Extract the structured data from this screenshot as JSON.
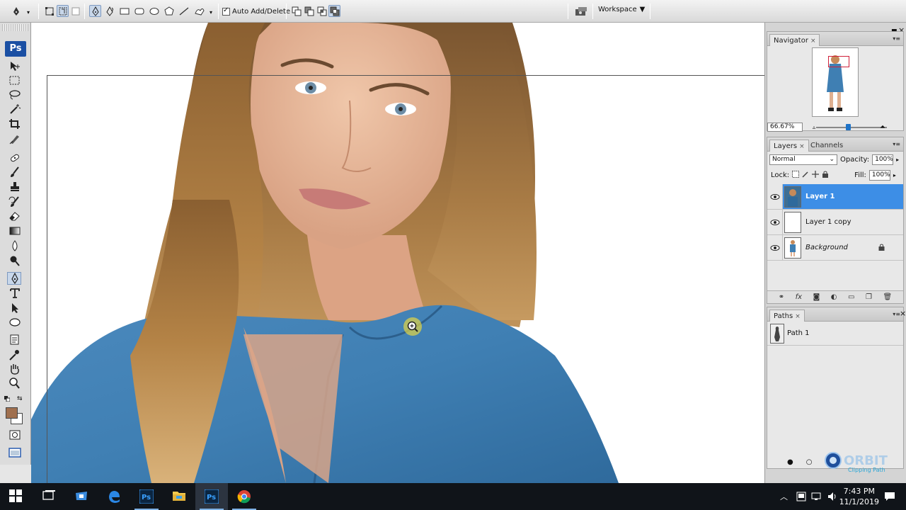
{
  "options_bar": {
    "auto_add_delete_label": "Auto Add/Delete",
    "auto_add_delete_checked": true,
    "workspace_label": "Workspace"
  },
  "toolbox": {
    "logo": "Ps",
    "foreground_color": "#a0704f",
    "background_color": "#ffffff",
    "selected_tool": "pen-tool"
  },
  "navigator": {
    "tab_label": "Navigator",
    "zoom": "66.67%",
    "zoom_slider_fraction": 0.45
  },
  "layers_panel": {
    "tabs": [
      "Layers",
      "Channels"
    ],
    "blend_mode": "Normal",
    "opacity_label": "Opacity:",
    "opacity_value": "100%",
    "lock_label": "Lock:",
    "fill_label": "Fill:",
    "fill_value": "100%",
    "layers": [
      {
        "name": "Layer 1",
        "visible": true,
        "selected": true,
        "locked": false
      },
      {
        "name": "Layer 1 copy",
        "visible": true,
        "selected": false,
        "locked": false
      },
      {
        "name": "Background",
        "visible": true,
        "selected": false,
        "locked": true
      }
    ]
  },
  "paths_panel": {
    "tab_label": "Paths",
    "paths": [
      {
        "name": "Path 1"
      }
    ]
  },
  "watermark": {
    "brand": "ORBIT",
    "tagline": "Clipping Path"
  },
  "taskbar": {
    "time": "7:43 PM",
    "date": "11/1/2019",
    "apps": [
      "start-icon",
      "task-view-icon",
      "store-icon",
      "edge-icon",
      "photoshop-icon",
      "file-explorer-icon",
      "photoshop-icon",
      "chrome-icon"
    ]
  },
  "colors": {
    "accent_selected": "#3d8ee6",
    "shirt_blue": "#4a86b8",
    "hair_brown": "#a5763f",
    "skin": "#e6b79a"
  }
}
